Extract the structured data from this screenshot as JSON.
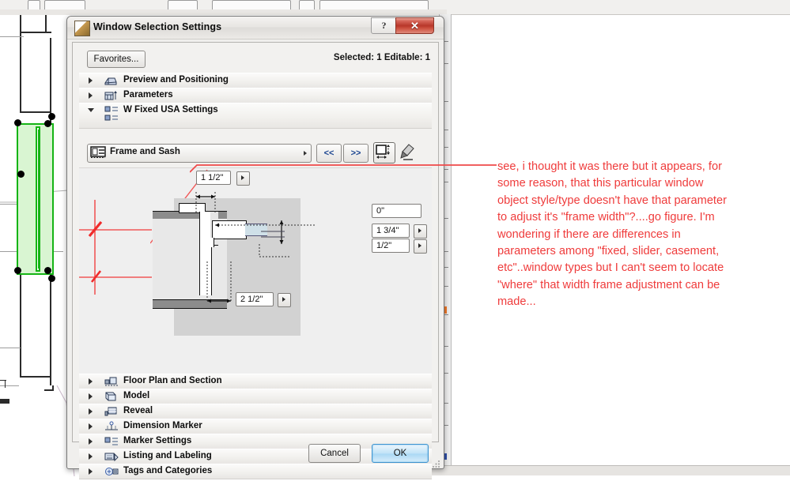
{
  "dialog": {
    "title": "Window Selection Settings",
    "app_icon": "archicad-logo-icon",
    "help_button": "?",
    "close_button": "✕",
    "favorites_button": "Favorites...",
    "status": "Selected: 1 Editable: 1",
    "cancel_button": "Cancel",
    "ok_button": "OK"
  },
  "tree": {
    "items": [
      {
        "label": "Preview and Positioning",
        "icon": "preview-positioning-icon",
        "expanded": false
      },
      {
        "label": "Parameters",
        "icon": "parameters-icon",
        "expanded": false
      },
      {
        "label": "W Fixed USA Settings",
        "icon": "fixed-usa-settings-icon",
        "expanded": true
      },
      {
        "label": "Floor Plan and Section",
        "icon": "floor-plan-section-icon",
        "expanded": false
      },
      {
        "label": "Model",
        "icon": "model-icon",
        "expanded": false
      },
      {
        "label": "Reveal",
        "icon": "reveal-icon",
        "expanded": false
      },
      {
        "label": "Dimension Marker",
        "icon": "dimension-marker-icon",
        "expanded": false
      },
      {
        "label": "Marker Settings",
        "icon": "marker-settings-icon",
        "expanded": false
      },
      {
        "label": "Listing and Labeling",
        "icon": "listing-labeling-icon",
        "expanded": false
      },
      {
        "label": "Tags and Categories",
        "icon": "tags-categories-icon",
        "expanded": false
      }
    ]
  },
  "toolbar": {
    "combo_value": "Frame and Sash",
    "combo_icon": "frame-sash-icon",
    "prev_label": "<<",
    "next_label": ">>",
    "resize_icon": "resize-dimension-icon",
    "pick_icon": "pick-up-parameters-icon"
  },
  "preview": {
    "fields": [
      {
        "name": "top-dimension",
        "value": "1 1/2\"",
        "spinner": true
      },
      {
        "name": "offset",
        "value": "0\"",
        "spinner": false
      },
      {
        "name": "sash-thickness",
        "value": "1 3/4\"",
        "spinner": true
      },
      {
        "name": "reveal-depth",
        "value": "1/2\"",
        "spinner": true
      },
      {
        "name": "bottom-dimension",
        "value": "2 1/2\"",
        "spinner": true
      }
    ]
  },
  "annotation": {
    "text": "see, i thought it was there but it appears, for some reason, that this particular window object style/type doesn't have that parameter to adjust it's \"frame width\"?....go figure. I'm wondering if there are differences in parameters among \"fixed, slider, casement, etc\"..window types but I can't seem to locate \"where\" that width frame adjustment can be made...",
    "color": "#ef3b3b"
  },
  "colors": {
    "selection_green": "#15b415",
    "annotation_red": "#ef3b3b",
    "close_red": "#b8372a",
    "ok_blue": "#3c93d0",
    "dialog_bg": "#f0efed"
  }
}
